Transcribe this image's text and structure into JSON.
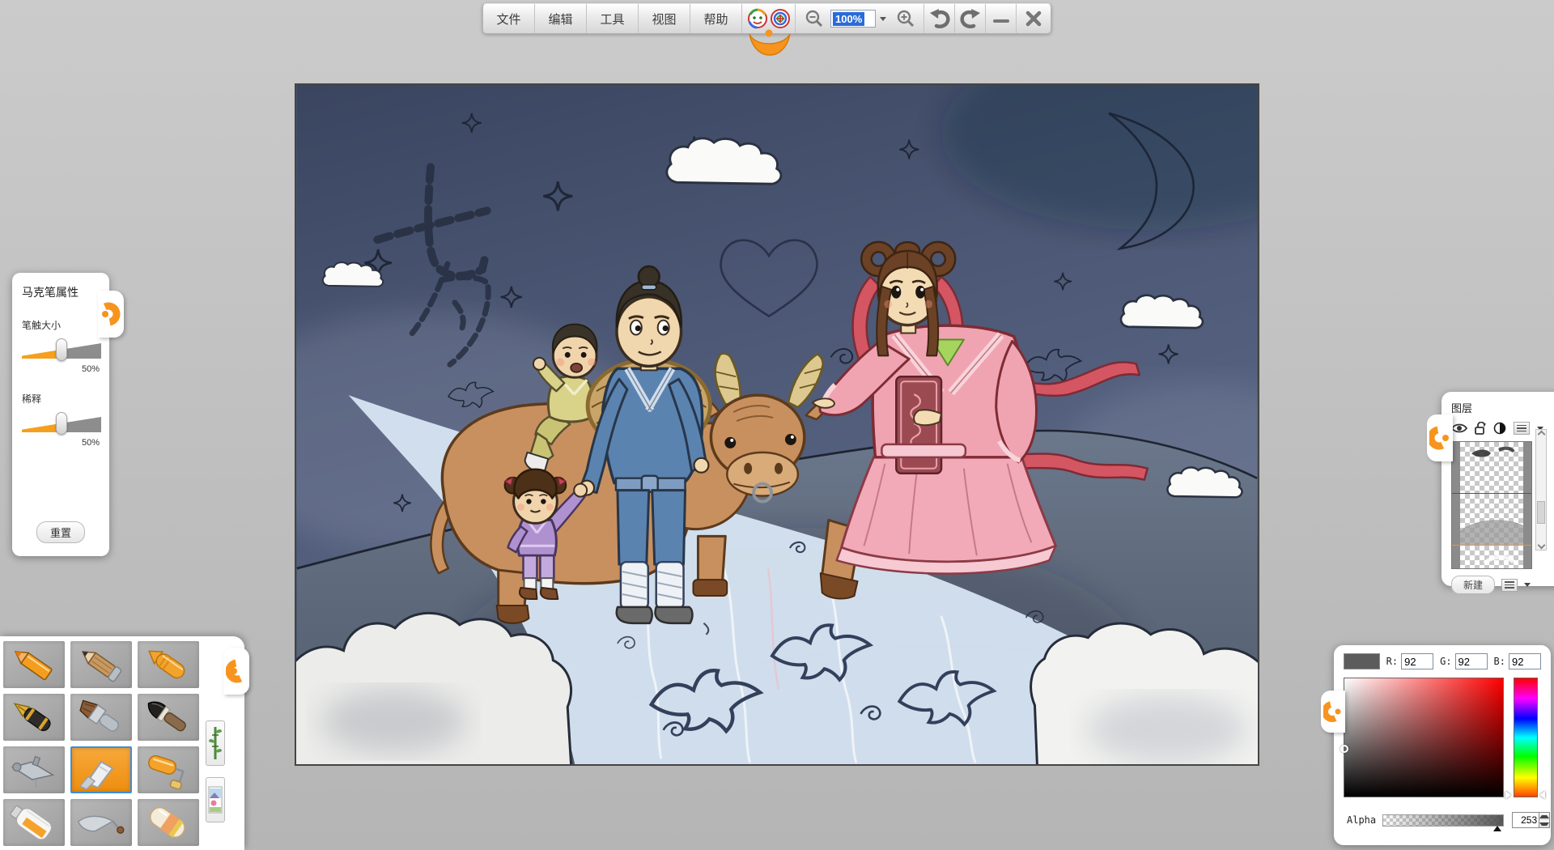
{
  "toolbar": {
    "menus": [
      "文件",
      "编辑",
      "工具",
      "视图",
      "帮助"
    ],
    "zoom_value": "100%",
    "icons": {
      "logo": "clown-face-logo",
      "zoom_out": "magnifier-minus",
      "zoom_in": "magnifier-plus",
      "undo": "undo-arrow",
      "redo": "redo-arrow",
      "minimize": "minus",
      "close": "x"
    }
  },
  "marker_panel": {
    "title": "马克笔属性",
    "brush_size_label": "笔触大小",
    "brush_size_value": "50%",
    "dilution_label": "稀释",
    "dilution_value": "50%",
    "reset_label": "重置"
  },
  "tool_palette": {
    "selected_tool": "marker",
    "tools": [
      {
        "name": "colored-pencil"
      },
      {
        "name": "pencil"
      },
      {
        "name": "crayon"
      },
      {
        "name": "fountain-pen"
      },
      {
        "name": "flat-brush"
      },
      {
        "name": "ink-brush"
      },
      {
        "name": "airbrush"
      },
      {
        "name": "marker"
      },
      {
        "name": "paint-roller"
      },
      {
        "name": "paint-tube"
      },
      {
        "name": "palette-knife"
      },
      {
        "name": "eraser"
      }
    ],
    "side_buttons": [
      "bamboo-stamp",
      "picture-stamp"
    ]
  },
  "layers_panel": {
    "title": "图层",
    "icons": [
      "visibility-eye",
      "unlock",
      "half-tone-circle",
      "layer-menu"
    ],
    "layers": [
      {
        "name": "sketch-layer",
        "selected": false
      },
      {
        "name": "paint-layer",
        "selected": true
      }
    ],
    "new_button_label": "新建"
  },
  "color_picker": {
    "r_label": "R:",
    "g_label": "G:",
    "b_label": "B:",
    "r": "92",
    "g": "92",
    "b": "92",
    "current_color": "#5C5C5C",
    "alpha_label": "Alpha",
    "alpha": "253"
  },
  "canvas": {
    "sketch_characters": "七夕",
    "char1": "七",
    "char2": "夕",
    "scene": "qixi-cowherd-weaver-girl-night-illustration"
  },
  "colors": {
    "accent_orange": "#F7941E",
    "selection_blue": "#2A6CD8",
    "selected_tile_border": "#3D8EDB",
    "sky": "#46536E",
    "milky_way": "#D5E3F1"
  }
}
